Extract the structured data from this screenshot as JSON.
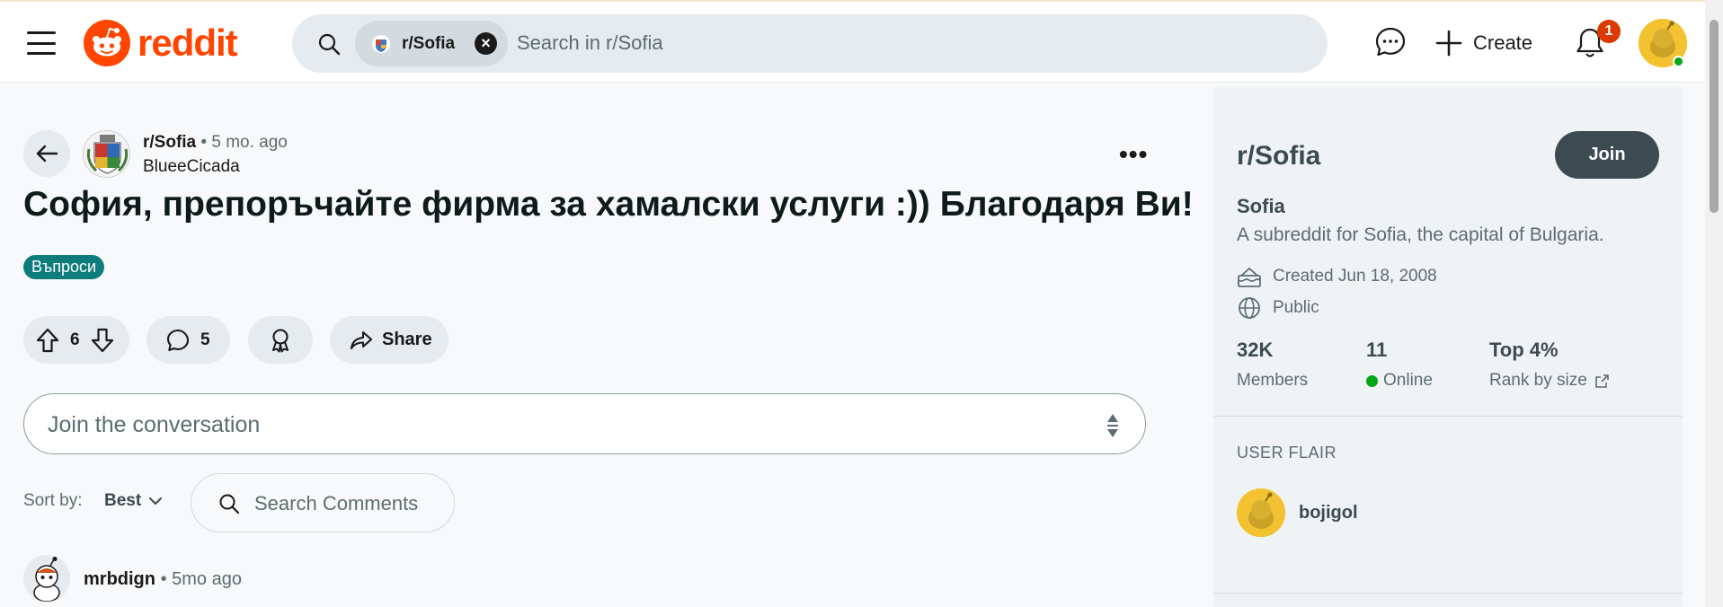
{
  "header": {
    "logo_text": "reddit",
    "search_chip": "r/Sofia",
    "search_chip_clear": "×",
    "search_placeholder": "Search in r/Sofia",
    "create_label": "Create",
    "notification_count": "1",
    "brand_color": "#ff4500"
  },
  "post": {
    "subreddit": "r/Sofia",
    "time": "5 mo. ago",
    "author": "BlueeCicada",
    "more": "•••",
    "title": "София, препоръчайте фирма за хамалски услуги :)) Благодаря Ви!",
    "flair": "Въпроси",
    "flair_color": "#0e7c7b",
    "votes": "6",
    "comments": "5",
    "share_label": "Share"
  },
  "composer": {
    "placeholder": "Join the conversation"
  },
  "comments": {
    "sort_label": "Sort by:",
    "sort_value": "Best",
    "search_placeholder": "Search Comments",
    "first": {
      "author": "mrbdign",
      "time": "5mo ago"
    }
  },
  "sidebar": {
    "title": "r/Sofia",
    "join_label": "Join",
    "name": "Sofia",
    "description": "A subreddit for Sofia, the capital of Bulgaria.",
    "created": "Created Jun 18, 2008",
    "visibility": "Public",
    "stats": [
      {
        "value": "32K",
        "label": "Members"
      },
      {
        "value": "11",
        "label": "Online"
      },
      {
        "value": "Top 4%",
        "label": "Rank by size"
      }
    ],
    "user_flair_heading": "USER FLAIR",
    "flair_username": "bojigol"
  }
}
